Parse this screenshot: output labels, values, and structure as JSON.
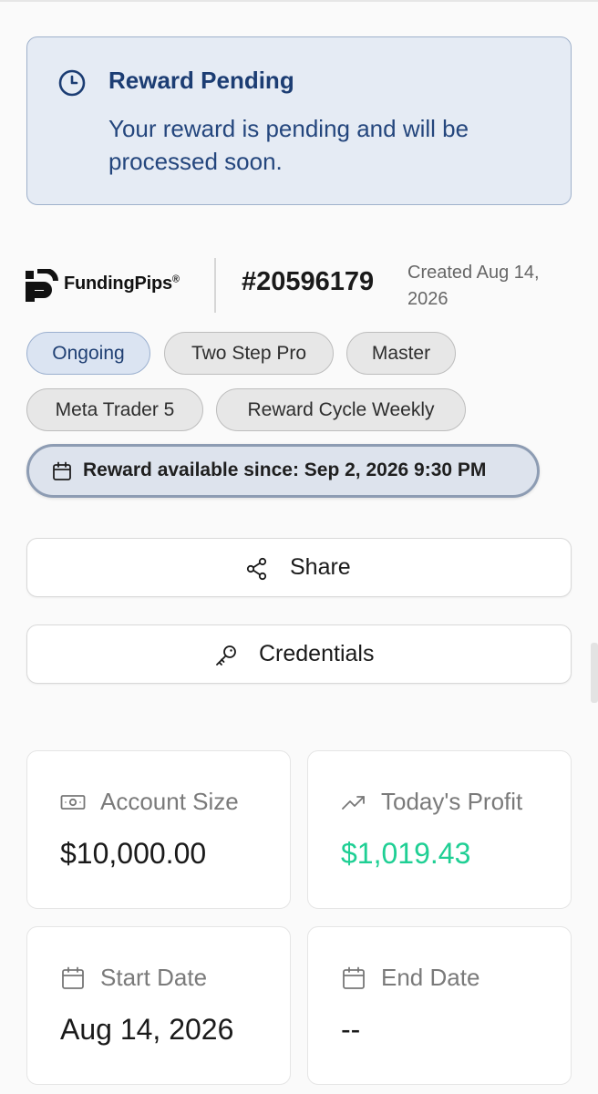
{
  "alert": {
    "title": "Reward Pending",
    "body": "Your reward is pending and will be processed soon.",
    "icon": "clock-icon",
    "color": "#1c3d73"
  },
  "header": {
    "brand": "FundingPips",
    "brand_mark": "®",
    "account_id": "#20596179",
    "created": "Created Aug 14, 2026"
  },
  "chips": [
    {
      "label": "Ongoing"
    },
    {
      "label": "Two Step Pro"
    },
    {
      "label": "Master"
    },
    {
      "label": "Meta Trader 5"
    },
    {
      "label": "Reward Cycle Weekly"
    }
  ],
  "availability": {
    "text": "Reward available since: Sep 2, 2026 9:30 PM",
    "icon": "calendar-icon"
  },
  "buttons": {
    "share": "Share",
    "credentials": "Credentials"
  },
  "stats": {
    "account_size": {
      "label": "Account Size",
      "value": "$10,000.00",
      "icon": "banknote-icon"
    },
    "todays_profit": {
      "label": "Today's Profit",
      "value": "$1,019.43",
      "icon": "trend-up-icon",
      "color": "#1fcf94"
    },
    "start_date": {
      "label": "Start Date",
      "value": "Aug 14, 2026",
      "icon": "calendar-icon"
    },
    "end_date": {
      "label": "End Date",
      "value": "--",
      "icon": "calendar-icon"
    }
  }
}
